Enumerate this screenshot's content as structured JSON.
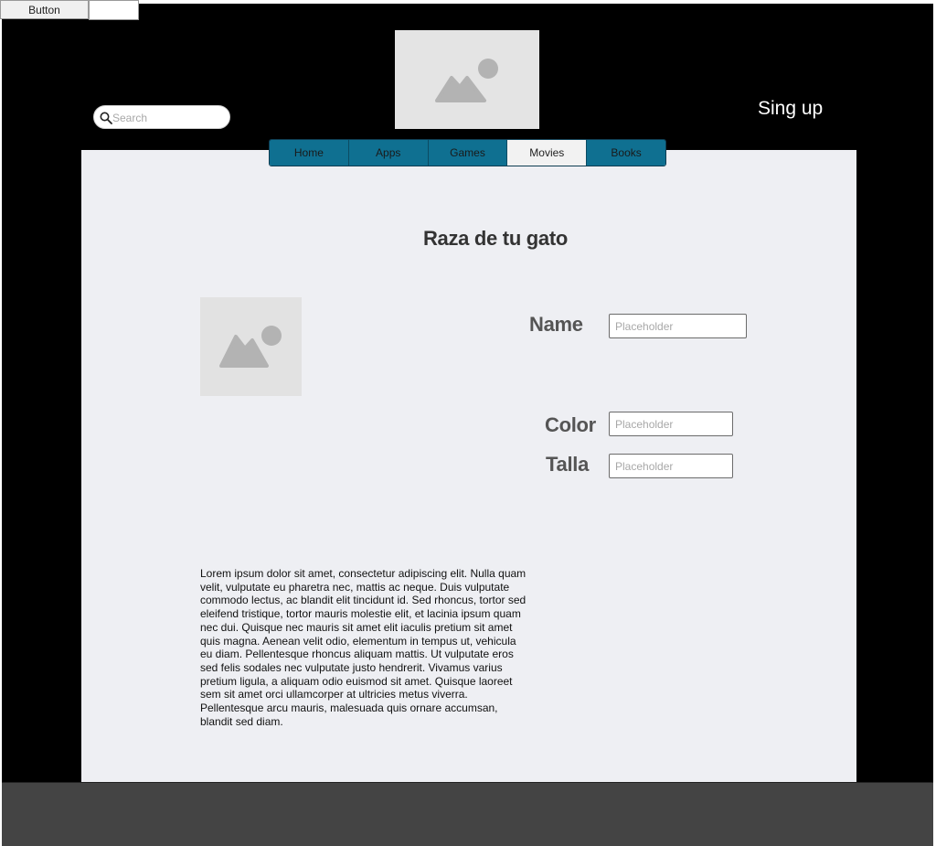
{
  "top_button": {
    "label": "Button"
  },
  "header": {
    "search_placeholder": "Search",
    "signup_label": "Sing up"
  },
  "nav": {
    "tabs": [
      {
        "label": "Home"
      },
      {
        "label": "Apps"
      },
      {
        "label": "Games"
      },
      {
        "label": "Movies"
      },
      {
        "label": "Books"
      }
    ],
    "active_tab": "Movies"
  },
  "main": {
    "title": "Raza de tu gato",
    "fields": [
      {
        "label": "Name",
        "placeholder": "Placeholder"
      },
      {
        "label": "Color",
        "placeholder": "Placeholder"
      },
      {
        "label": "Talla",
        "placeholder": "Placeholder"
      }
    ],
    "description": "Lorem ipsum dolor sit amet, consectetur adipiscing elit. Nulla quam velit, vulputate eu pharetra nec, mattis ac neque. Duis vulputate commodo lectus, ac blandit elit tincidunt id. Sed rhoncus, tortor sed eleifend tristique, tortor mauris molestie elit, et lacinia ipsum quam nec dui. Quisque nec mauris sit amet elit iaculis pretium sit amet quis magna. Aenean velit odio, elementum in tempus ut, vehicula eu diam. Pellentesque rhoncus aliquam mattis. Ut vulputate eros sed felis sodales nec vulputate justo hendrerit. Vivamus varius pretium ligula, a aliquam odio euismod sit amet. Quisque laoreet sem sit amet orci ullamcorper at ultricies metus viverra. Pellentesque arcu mauris, malesuada quis ornare accumsan, blandit sed diam."
  },
  "icons": {
    "image_placeholder": "image-placeholder-icon",
    "search": "search-icon"
  },
  "colors": {
    "frame": "#000000",
    "panel": "#eeeff3",
    "tab": "#0f7091",
    "tab_active": "#f2f2f2",
    "footer": "#444444"
  }
}
